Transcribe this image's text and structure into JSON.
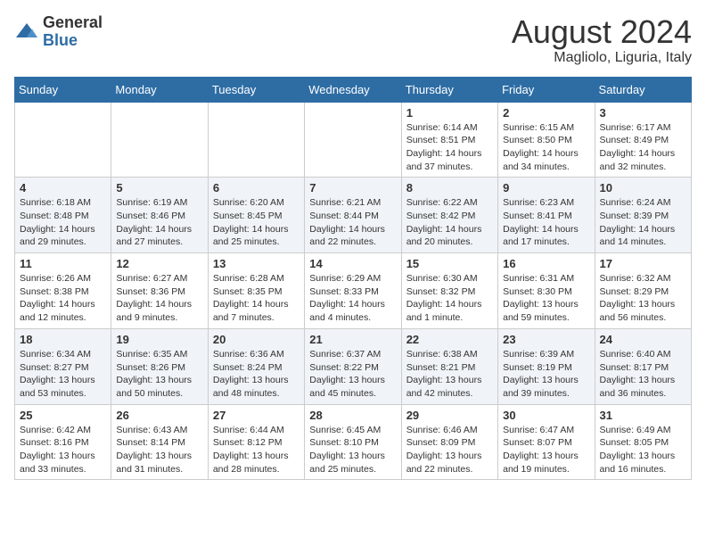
{
  "logo": {
    "general": "General",
    "blue": "Blue"
  },
  "title": "August 2024",
  "subtitle": "Magliolo, Liguria, Italy",
  "weekdays": [
    "Sunday",
    "Monday",
    "Tuesday",
    "Wednesday",
    "Thursday",
    "Friday",
    "Saturday"
  ],
  "weeks": [
    [
      {
        "day": "",
        "content": ""
      },
      {
        "day": "",
        "content": ""
      },
      {
        "day": "",
        "content": ""
      },
      {
        "day": "",
        "content": ""
      },
      {
        "day": "1",
        "content": "Sunrise: 6:14 AM\nSunset: 8:51 PM\nDaylight: 14 hours and 37 minutes."
      },
      {
        "day": "2",
        "content": "Sunrise: 6:15 AM\nSunset: 8:50 PM\nDaylight: 14 hours and 34 minutes."
      },
      {
        "day": "3",
        "content": "Sunrise: 6:17 AM\nSunset: 8:49 PM\nDaylight: 14 hours and 32 minutes."
      }
    ],
    [
      {
        "day": "4",
        "content": "Sunrise: 6:18 AM\nSunset: 8:48 PM\nDaylight: 14 hours and 29 minutes."
      },
      {
        "day": "5",
        "content": "Sunrise: 6:19 AM\nSunset: 8:46 PM\nDaylight: 14 hours and 27 minutes."
      },
      {
        "day": "6",
        "content": "Sunrise: 6:20 AM\nSunset: 8:45 PM\nDaylight: 14 hours and 25 minutes."
      },
      {
        "day": "7",
        "content": "Sunrise: 6:21 AM\nSunset: 8:44 PM\nDaylight: 14 hours and 22 minutes."
      },
      {
        "day": "8",
        "content": "Sunrise: 6:22 AM\nSunset: 8:42 PM\nDaylight: 14 hours and 20 minutes."
      },
      {
        "day": "9",
        "content": "Sunrise: 6:23 AM\nSunset: 8:41 PM\nDaylight: 14 hours and 17 minutes."
      },
      {
        "day": "10",
        "content": "Sunrise: 6:24 AM\nSunset: 8:39 PM\nDaylight: 14 hours and 14 minutes."
      }
    ],
    [
      {
        "day": "11",
        "content": "Sunrise: 6:26 AM\nSunset: 8:38 PM\nDaylight: 14 hours and 12 minutes."
      },
      {
        "day": "12",
        "content": "Sunrise: 6:27 AM\nSunset: 8:36 PM\nDaylight: 14 hours and 9 minutes."
      },
      {
        "day": "13",
        "content": "Sunrise: 6:28 AM\nSunset: 8:35 PM\nDaylight: 14 hours and 7 minutes."
      },
      {
        "day": "14",
        "content": "Sunrise: 6:29 AM\nSunset: 8:33 PM\nDaylight: 14 hours and 4 minutes."
      },
      {
        "day": "15",
        "content": "Sunrise: 6:30 AM\nSunset: 8:32 PM\nDaylight: 14 hours and 1 minute."
      },
      {
        "day": "16",
        "content": "Sunrise: 6:31 AM\nSunset: 8:30 PM\nDaylight: 13 hours and 59 minutes."
      },
      {
        "day": "17",
        "content": "Sunrise: 6:32 AM\nSunset: 8:29 PM\nDaylight: 13 hours and 56 minutes."
      }
    ],
    [
      {
        "day": "18",
        "content": "Sunrise: 6:34 AM\nSunset: 8:27 PM\nDaylight: 13 hours and 53 minutes."
      },
      {
        "day": "19",
        "content": "Sunrise: 6:35 AM\nSunset: 8:26 PM\nDaylight: 13 hours and 50 minutes."
      },
      {
        "day": "20",
        "content": "Sunrise: 6:36 AM\nSunset: 8:24 PM\nDaylight: 13 hours and 48 minutes."
      },
      {
        "day": "21",
        "content": "Sunrise: 6:37 AM\nSunset: 8:22 PM\nDaylight: 13 hours and 45 minutes."
      },
      {
        "day": "22",
        "content": "Sunrise: 6:38 AM\nSunset: 8:21 PM\nDaylight: 13 hours and 42 minutes."
      },
      {
        "day": "23",
        "content": "Sunrise: 6:39 AM\nSunset: 8:19 PM\nDaylight: 13 hours and 39 minutes."
      },
      {
        "day": "24",
        "content": "Sunrise: 6:40 AM\nSunset: 8:17 PM\nDaylight: 13 hours and 36 minutes."
      }
    ],
    [
      {
        "day": "25",
        "content": "Sunrise: 6:42 AM\nSunset: 8:16 PM\nDaylight: 13 hours and 33 minutes."
      },
      {
        "day": "26",
        "content": "Sunrise: 6:43 AM\nSunset: 8:14 PM\nDaylight: 13 hours and 31 minutes."
      },
      {
        "day": "27",
        "content": "Sunrise: 6:44 AM\nSunset: 8:12 PM\nDaylight: 13 hours and 28 minutes."
      },
      {
        "day": "28",
        "content": "Sunrise: 6:45 AM\nSunset: 8:10 PM\nDaylight: 13 hours and 25 minutes."
      },
      {
        "day": "29",
        "content": "Sunrise: 6:46 AM\nSunset: 8:09 PM\nDaylight: 13 hours and 22 minutes."
      },
      {
        "day": "30",
        "content": "Sunrise: 6:47 AM\nSunset: 8:07 PM\nDaylight: 13 hours and 19 minutes."
      },
      {
        "day": "31",
        "content": "Sunrise: 6:49 AM\nSunset: 8:05 PM\nDaylight: 13 hours and 16 minutes."
      }
    ]
  ]
}
